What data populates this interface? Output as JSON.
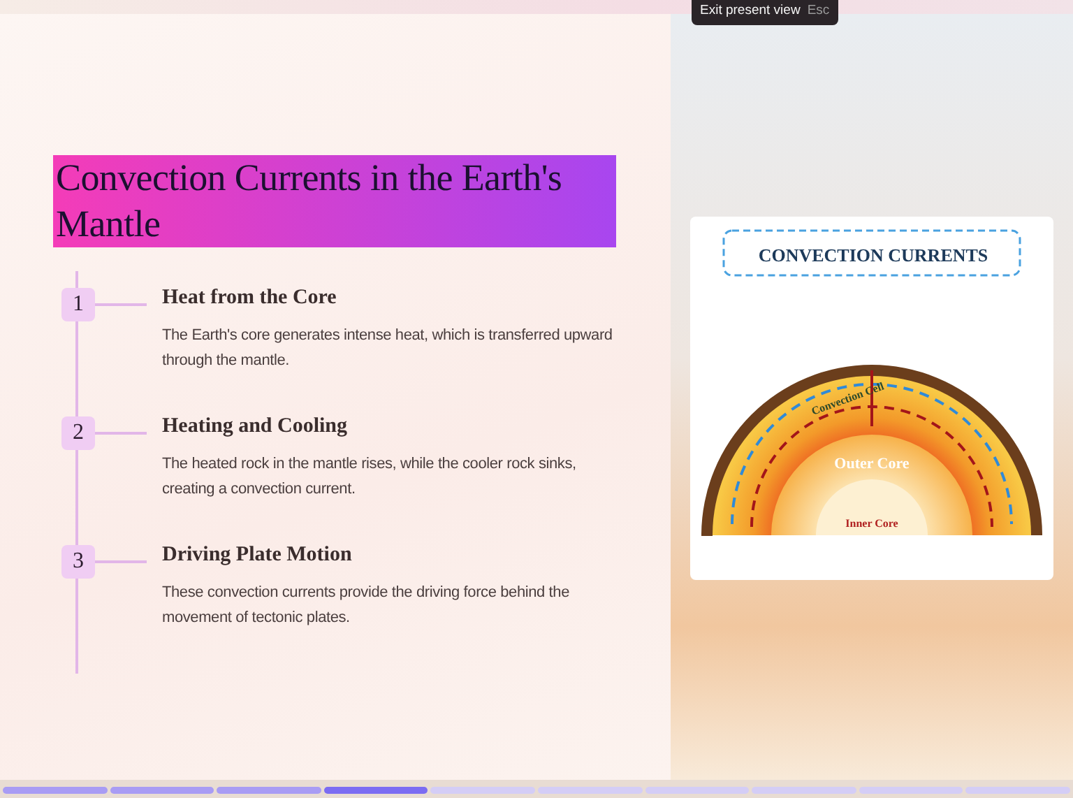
{
  "tooltip": {
    "label": "Exit present view",
    "shortcut": "Esc"
  },
  "slide": {
    "title": "Convection Currents in the Earth's Mantle",
    "steps": [
      {
        "number": "1",
        "heading": "Heat from the Core",
        "text": "The Earth's core generates intense heat, which is transferred upward through the mantle."
      },
      {
        "number": "2",
        "heading": "Heating and Cooling",
        "text": "The heated rock in the mantle rises, while the cooler rock sinks, creating a convection current."
      },
      {
        "number": "3",
        "heading": "Driving Plate Motion",
        "text": "These convection currents provide the driving force behind the movement of tectonic plates."
      }
    ],
    "diagram": {
      "title": "CONVECTION CURRENTS",
      "labels": [
        {
          "kind": "cell",
          "text": "Convection Cell"
        },
        {
          "kind": "outer",
          "text": "Outer Core"
        },
        {
          "kind": "inner",
          "text": "Inner Core"
        }
      ]
    }
  },
  "progress": [
    {
      "completed": true,
      "selected": false
    },
    {
      "completed": true,
      "selected": false
    },
    {
      "completed": true,
      "selected": false
    },
    {
      "completed": true,
      "selected": true
    },
    {
      "completed": false,
      "selected": false
    },
    {
      "completed": false,
      "selected": false
    },
    {
      "completed": false,
      "selected": false
    },
    {
      "completed": false,
      "selected": false
    },
    {
      "completed": false,
      "selected": false
    },
    {
      "completed": false,
      "selected": false
    }
  ]
}
